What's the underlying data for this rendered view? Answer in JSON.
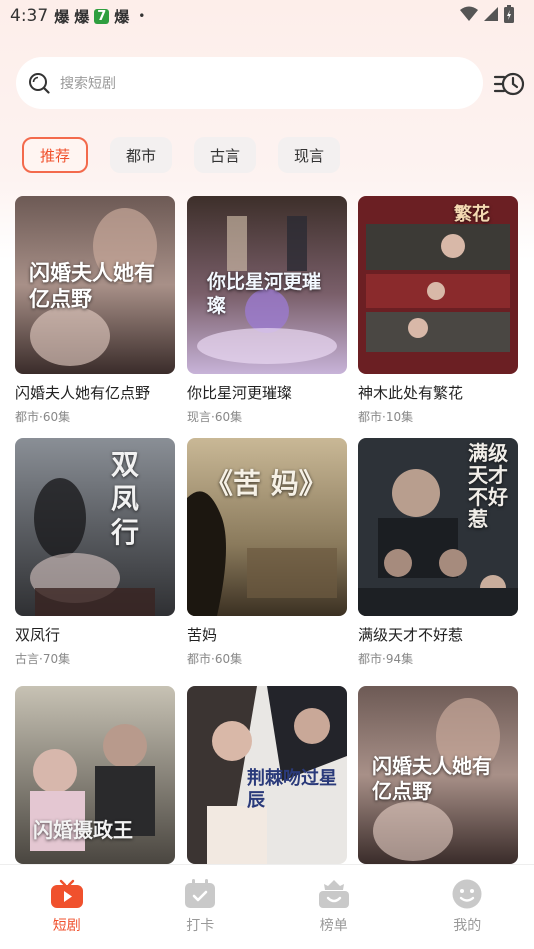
{
  "status_bar": {
    "time": "4:37",
    "notifications": [
      "爆",
      "爆",
      "7",
      "爆"
    ],
    "dot": "•"
  },
  "search": {
    "placeholder": "搜索短剧",
    "icon": "search-icon",
    "history_icon": "history-icon"
  },
  "category_tabs": [
    {
      "label": "推荐",
      "active": true
    },
    {
      "label": "都市"
    },
    {
      "label": "古言"
    },
    {
      "label": "现言"
    }
  ],
  "dramas": [
    {
      "title": "闪婚夫人她有亿点野",
      "meta": "都市·60集",
      "poster_text": "闪婚夫人她有亿点野"
    },
    {
      "title": "你比星河更璀璨",
      "meta": "现言·60集",
      "poster_text": "你比星河更璀璨"
    },
    {
      "title": "神木此处有繁花",
      "meta": "都市·10集",
      "poster_text": "繁花"
    },
    {
      "title": "双凤行",
      "meta": "古言·70集",
      "poster_text": "双凤行"
    },
    {
      "title": "苦妈",
      "meta": "都市·60集",
      "poster_text": "《苦 妈》"
    },
    {
      "title": "满级天才不好惹",
      "meta": "都市·94集",
      "poster_text": "满级天才不好惹"
    },
    {
      "title": "",
      "meta": "",
      "poster_text": "闪婚摄政王"
    },
    {
      "title": "",
      "meta": "",
      "poster_text": "荆棘吻过星辰"
    },
    {
      "title": "",
      "meta": "",
      "poster_text": "闪婚夫人她有亿点野"
    }
  ],
  "bottom_nav": [
    {
      "label": "短剧",
      "icon": "tv-icon",
      "active": true
    },
    {
      "label": "打卡",
      "icon": "calendar-check-icon"
    },
    {
      "label": "榜单",
      "icon": "ranking-icon"
    },
    {
      "label": "我的",
      "icon": "profile-icon"
    }
  ],
  "colors": {
    "accent": "#f0512d",
    "background_top": "#fdeeea",
    "inactive": "#999999"
  }
}
